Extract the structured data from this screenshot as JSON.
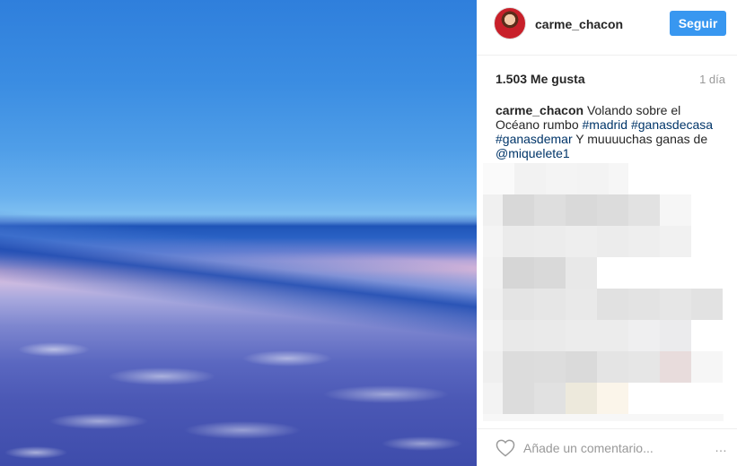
{
  "post": {
    "username": "carme_chacon",
    "follow_label": "Seguir",
    "likes": "1.503 Me gusta",
    "time": "1 día",
    "caption": {
      "user": "carme_chacon",
      "text1": "Volando sobre el Océano rumbo",
      "tag1": "#madrid",
      "tag2": "#ganasdecasa",
      "tag3": "#ganasdemar",
      "text2": "Y muuuuchas ganas de",
      "mention": "@miquelete1"
    },
    "comment_placeholder": "Añade un comentario...",
    "more_icon": "…"
  },
  "icons": {
    "heart": "heart-icon",
    "more": "ellipsis-icon"
  },
  "colors": {
    "follow_button": "#3897f0",
    "hashtag": "#003569",
    "muted": "#999999"
  }
}
